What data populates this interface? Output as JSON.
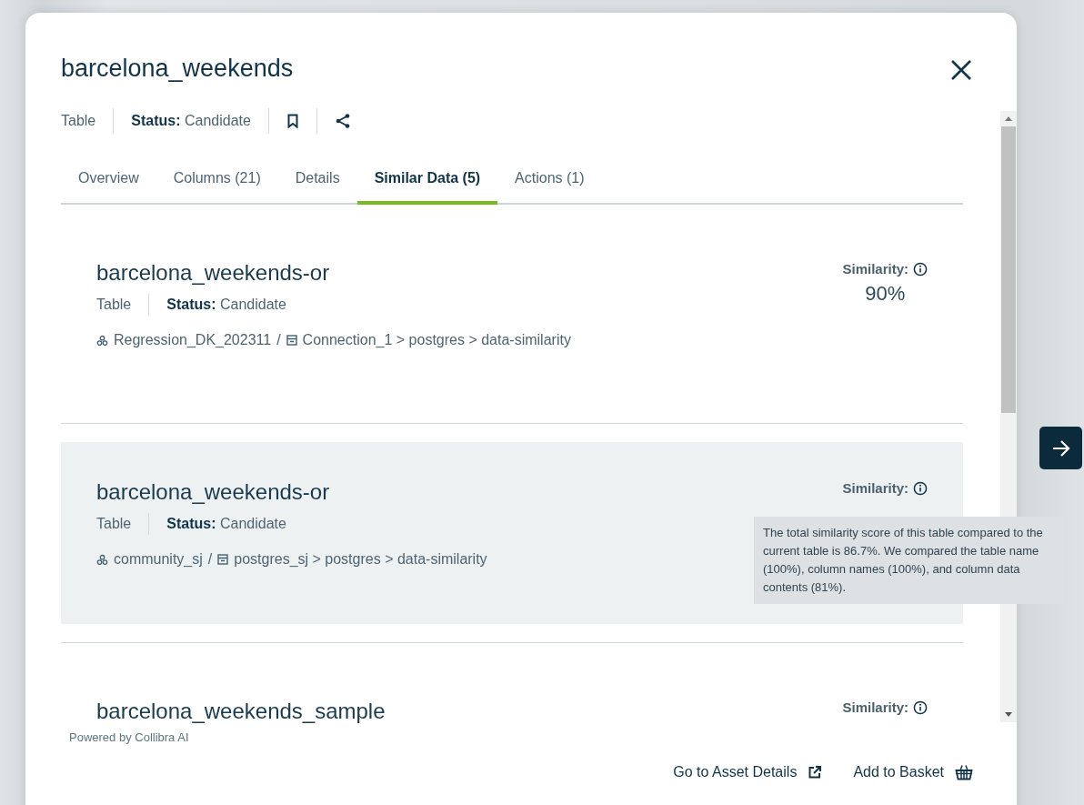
{
  "dialog": {
    "title": "barcelona_weekends",
    "type": "Table",
    "status_label": "Status:",
    "status": "Candidate"
  },
  "tabs": [
    {
      "label": "Overview",
      "selected": false
    },
    {
      "label": "Columns (21)",
      "selected": false
    },
    {
      "label": "Details",
      "selected": false
    },
    {
      "label": "Similar Data (5)",
      "selected": true
    },
    {
      "label": "Actions (1)",
      "selected": false
    }
  ],
  "results": [
    {
      "name": "barcelona_weekends-or",
      "type": "Table",
      "status_label": "Status:",
      "status": "Candidate",
      "community": "Regression_DK_202311",
      "separator": "/",
      "location": "Connection_1 > postgres > data-similarity",
      "similarity_label": "Similarity:",
      "score": "90%",
      "highlighted": false
    },
    {
      "name": "barcelona_weekends-or",
      "type": "Table",
      "status_label": "Status:",
      "status": "Candidate",
      "community": "community_sj",
      "separator": "/",
      "location": "postgres_sj > postgres > data-similarity",
      "similarity_label": "Similarity:",
      "highlighted": true,
      "tooltip": "The total similarity score of this table compared to the current table is 86.7%. We compared the table name (100%), column names (100%), and column data contents (81%)."
    },
    {
      "name": "barcelona_weekends_sample",
      "similarity_label": "Similarity:",
      "highlighted": false
    }
  ],
  "footer": {
    "powered_by": "Powered by Collibra AI",
    "actions": [
      {
        "label": "Go to Asset Details",
        "kind": "link"
      },
      {
        "label": "Add to Basket",
        "kind": "basket"
      }
    ]
  }
}
